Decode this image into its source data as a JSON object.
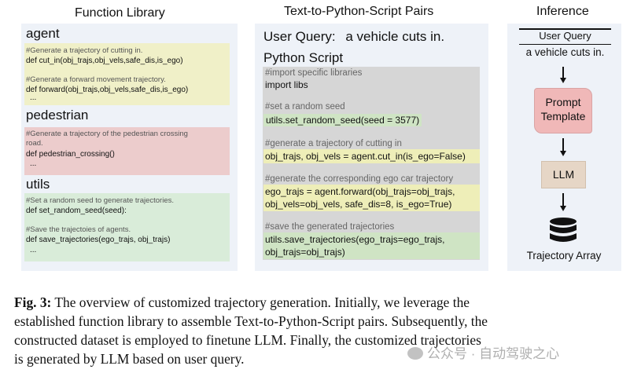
{
  "titles": {
    "function_library": "Function Library",
    "pairs": "Text-to-Python-Script Pairs",
    "inference": "Inference"
  },
  "library": {
    "agent": {
      "heading": "agent",
      "c1": "#Generate a trajectory of cutting in.",
      "d1": "def cut_in(obj_trajs,obj_vels,safe_dis,is_ego)",
      "c2": "#Generate a forward movement trajectory.",
      "d2": "def forward(obj_trajs,obj_vels,safe_dis,is_ego)",
      "ellipsis": "..."
    },
    "pedestrian": {
      "heading": "pedestrian",
      "c1a": "#Generate a trajectory of the pedestrian crossing",
      "c1b": "road.",
      "d1": "def pedestrian_crossing()",
      "ellipsis": "..."
    },
    "utils": {
      "heading": "utils",
      "c1": "#Set a random seed to generate  trajectories.",
      "d1": "def set_random_seed(seed):",
      "c2": "#Save the trajectoies of agents.",
      "d2": "def save_trajectories(ego_trajs, obj_trajs)",
      "ellipsis": "..."
    }
  },
  "pairs": {
    "query_label": "User Query:",
    "query_text": "a vehicle cuts in.",
    "script_label": "Python Script",
    "lines": {
      "c1": "#import specific libraries",
      "l1": "import libs",
      "c2": "#set  a random seed",
      "l2": "utils.set_random_seed(seed = 3577)",
      "c3": "#generate a trajectory of cutting in",
      "l3": "obj_trajs, obj_vels = agent.cut_in(is_ego=False)",
      "c4": "#generate the corresponding ego car trajectory",
      "l4a": "ego_trajs = agent.forward(obj_trajs=obj_trajs,",
      "l4b": "obj_vels=obj_vels, safe_dis=8, is_ego=True)",
      "c5": "#save the generated trajectories",
      "l5a": "utils.save_trajectories(ego_trajs=ego_trajs,",
      "l5b": "obj_trajs=obj_trajs)"
    }
  },
  "inference": {
    "query_label": "User Query",
    "query_text": "a vehicle cuts in.",
    "prompt_l1": "Prompt",
    "prompt_l2": "Template",
    "llm": "LLM",
    "output": "Trajectory Array"
  },
  "caption": {
    "fig": "Fig. 3:",
    "l1": " The overview of customized trajectory generation. Initially, we leverage the",
    "l2": "established function library to assemble Text-to-Python-Script pairs. Subsequently, the",
    "l3": "constructed dataset is employed to finetune LLM. Finally, the customized trajectories",
    "l4": "is generated by LLM based on user query."
  },
  "watermark": "公众号 · 自动驾驶之心",
  "colors": {
    "panel": "#eef2f8",
    "yellow": "#f0f0c8",
    "red": "#eccccc",
    "green": "#d9ecd9",
    "prompt": "#f0b8b8",
    "llm": "#e6d6c6"
  }
}
